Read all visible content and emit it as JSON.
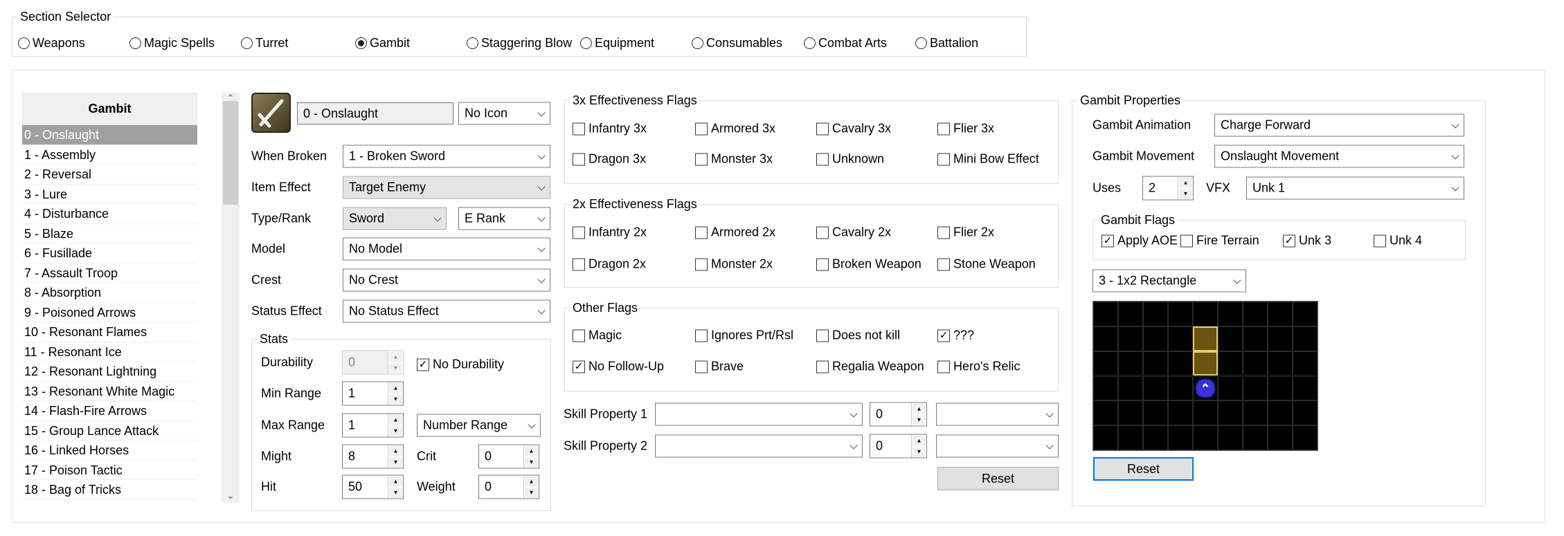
{
  "section_selector": {
    "title": "Section Selector",
    "options": [
      "Weapons",
      "Magic Spells",
      "Turret",
      "Gambit",
      "Staggering Blow",
      "Equipment",
      "Consumables",
      "Combat Arts",
      "Battalion"
    ],
    "selected": "Gambit"
  },
  "list": {
    "header": "Gambit",
    "items": [
      "0 - Onslaught",
      "1 - Assembly",
      "2 - Reversal",
      "3 - Lure",
      "4 - Disturbance",
      "5 - Blaze",
      "6 - Fusillade",
      "7 - Assault Troop",
      "8 - Absorption",
      "9 - Poisoned Arrows",
      "10 - Resonant Flames",
      "11 - Resonant Ice",
      "12 - Resonant Lightning",
      "13 - Resonant White Magic",
      "14 - Flash-Fire Arrows",
      "15 - Group Lance Attack",
      "16 - Linked Horses",
      "17 - Poison Tactic",
      "18 - Bag of Tricks"
    ],
    "selected": "0 - Onslaught"
  },
  "item": {
    "name": "0 - Onslaught",
    "icon": "No Icon",
    "icon_glyph": "sword-icon",
    "when_broken_label": "When Broken",
    "when_broken": "1 - Broken Sword",
    "item_effect_label": "Item Effect",
    "item_effect": "Target Enemy",
    "type_rank_label": "Type/Rank",
    "type": "Sword",
    "rank": "E Rank",
    "model_label": "Model",
    "model": "No Model",
    "crest_label": "Crest",
    "crest": "No Crest",
    "status_label": "Status Effect",
    "status": "No Status Effect"
  },
  "stats": {
    "title": "Stats",
    "durability_label": "Durability",
    "durability": "0",
    "no_durability_label": "No Durability",
    "no_durability": true,
    "min_range_label": "Min Range",
    "min_range": "1",
    "max_range_label": "Max Range",
    "max_range": "1",
    "range_type": "Number Range",
    "might_label": "Might",
    "might": "8",
    "crit_label": "Crit",
    "crit": "0",
    "hit_label": "Hit",
    "hit": "50",
    "weight_label": "Weight",
    "weight": "0"
  },
  "flags_3x": {
    "title": "3x Effectiveness Flags",
    "items": [
      {
        "label": "Infantry 3x",
        "checked": false
      },
      {
        "label": "Armored 3x",
        "checked": false
      },
      {
        "label": "Cavalry 3x",
        "checked": false
      },
      {
        "label": "Flier 3x",
        "checked": false
      },
      {
        "label": "Dragon 3x",
        "checked": false
      },
      {
        "label": "Monster 3x",
        "checked": false
      },
      {
        "label": "Unknown",
        "checked": false
      },
      {
        "label": "Mini Bow Effect",
        "checked": false
      }
    ]
  },
  "flags_2x": {
    "title": "2x Effectiveness Flags",
    "items": [
      {
        "label": "Infantry 2x",
        "checked": false
      },
      {
        "label": "Armored 2x",
        "checked": false
      },
      {
        "label": "Cavalry 2x",
        "checked": false
      },
      {
        "label": "Flier 2x",
        "checked": false
      },
      {
        "label": "Dragon 2x",
        "checked": false
      },
      {
        "label": "Monster 2x",
        "checked": false
      },
      {
        "label": "Broken Weapon",
        "checked": false
      },
      {
        "label": "Stone Weapon",
        "checked": false
      }
    ]
  },
  "flags_other": {
    "title": "Other Flags",
    "items": [
      {
        "label": "Magic",
        "checked": false
      },
      {
        "label": "Ignores Prt/Rsl",
        "checked": false
      },
      {
        "label": "Does not kill",
        "checked": false
      },
      {
        "label": "???",
        "checked": true
      },
      {
        "label": "No Follow-Up",
        "checked": true
      },
      {
        "label": "Brave",
        "checked": false
      },
      {
        "label": "Regalia Weapon",
        "checked": false
      },
      {
        "label": "Hero's Relic",
        "checked": false
      }
    ]
  },
  "skill_props": [
    {
      "label": "Skill Property 1",
      "value": "",
      "amount": "0",
      "extra": ""
    },
    {
      "label": "Skill Property 2",
      "value": "",
      "amount": "0",
      "extra": ""
    }
  ],
  "reset_label": "Reset",
  "gambit": {
    "title": "Gambit Properties",
    "animation_label": "Gambit Animation",
    "animation": "Charge Forward",
    "movement_label": "Gambit Movement",
    "movement": "Onslaught Movement",
    "uses_label": "Uses",
    "uses": "2",
    "vfx_label": "VFX",
    "vfx": "Unk 1",
    "flags_title": "Gambit Flags",
    "flags": [
      {
        "label": "Apply AOE",
        "checked": true
      },
      {
        "label": "Fire Terrain",
        "checked": false
      },
      {
        "label": "Unk 3",
        "checked": true
      },
      {
        "label": "Unk 4",
        "checked": false
      }
    ],
    "shape": "3 - 1x2 Rectangle",
    "grid": {
      "cols": 9,
      "rows": 6,
      "aoe_cells": [
        [
          4,
          1
        ],
        [
          4,
          2
        ]
      ],
      "origin_cell": [
        4,
        3
      ]
    },
    "reset_label": "Reset",
    "colors": {
      "aoe": "#6b5410",
      "aoe_border": "#e8cf6a",
      "origin": "#3a32d8"
    }
  }
}
